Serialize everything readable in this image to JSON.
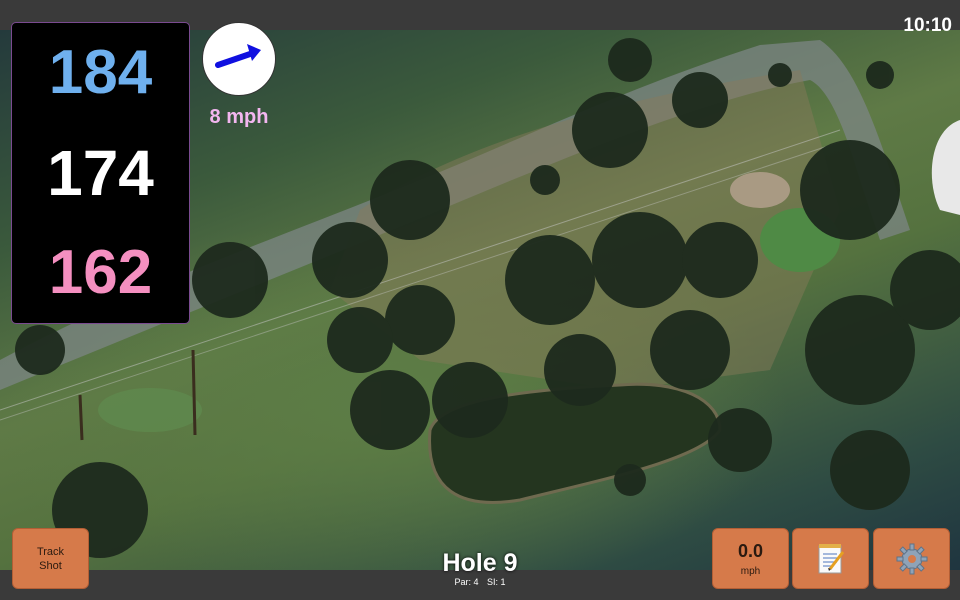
{
  "status": {
    "time": "10:10"
  },
  "distances": {
    "back": "184",
    "center": "174",
    "front": "162"
  },
  "wind": {
    "speed": "8 mph",
    "icon": "wind-direction-arrow-icon"
  },
  "buttons": {
    "track_shot_line1": "Track",
    "track_shot_line2": "Shot",
    "speed_value": "0.0",
    "speed_unit": "mph",
    "notes_icon": "notepad-icon",
    "settings_icon": "gear-icon"
  },
  "hole": {
    "title": "Hole 9",
    "par": "Par: 4",
    "si": "SI: 1"
  },
  "colors": {
    "back": "#6fb0ee",
    "center": "#ffffff",
    "front": "#f48fc0",
    "button": "#d67a4a",
    "wind_text": "#f3b6f0"
  }
}
